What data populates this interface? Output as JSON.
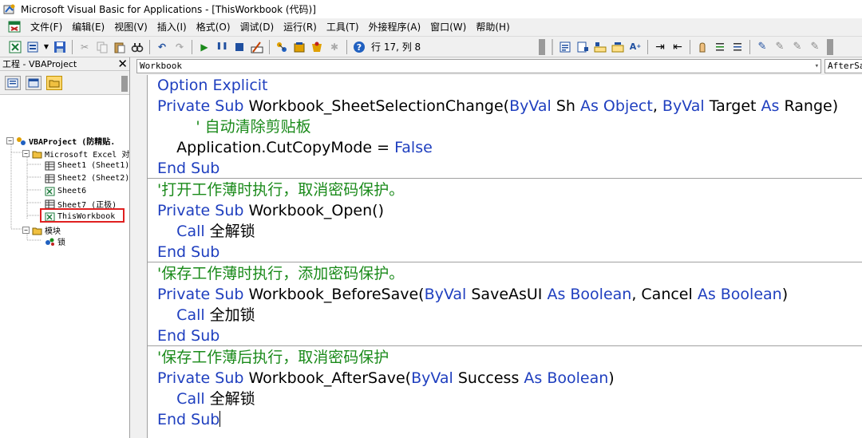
{
  "window": {
    "title": "Microsoft Visual Basic for Applications - [ThisWorkbook (代码)]"
  },
  "menu": [
    "文件(F)",
    "编辑(E)",
    "视图(V)",
    "插入(I)",
    "格式(O)",
    "调试(D)",
    "运行(R)",
    "工具(T)",
    "外接程序(A)",
    "窗口(W)",
    "帮助(H)"
  ],
  "toolbar": {
    "cursor_position": "行 17, 列 8"
  },
  "project": {
    "title": "工程 - VBAProject",
    "close_glyph": "✕",
    "root": "VBAProject (防精贴.",
    "excel_folder": "Microsoft Excel 对",
    "sheets": [
      "Sheet1 (Sheet1)",
      "Sheet2 (Sheet2)",
      "Sheet6",
      "Sheet7 (正极)"
    ],
    "this_workbook": "ThisWorkbook",
    "modules_folder": "模块",
    "module_item": "锁"
  },
  "code": {
    "object_combo": "Workbook",
    "proc_combo": "AfterSave",
    "lines": [
      [
        {
          "t": "Option Explicit",
          "c": "kw"
        }
      ],
      [
        {
          "t": "Private Sub",
          "c": "kw"
        },
        {
          "t": " Workbook_SheetSelectionChange(",
          "c": ""
        },
        {
          "t": "ByVal",
          "c": "kw"
        },
        {
          "t": " Sh ",
          "c": ""
        },
        {
          "t": "As Object",
          "c": "kw"
        },
        {
          "t": ", ",
          "c": ""
        },
        {
          "t": "ByVal",
          "c": "kw"
        },
        {
          "t": " Target ",
          "c": ""
        },
        {
          "t": "As",
          "c": "kw"
        },
        {
          "t": " Range)",
          "c": ""
        }
      ],
      [
        {
          "t": "        ' 自动清除剪贴板",
          "c": "cm"
        }
      ],
      [
        {
          "t": "    Application.CutCopyMode = ",
          "c": ""
        },
        {
          "t": "False",
          "c": "kw"
        }
      ],
      [
        {
          "t": "End Sub",
          "c": "kw"
        }
      ],
      [
        {
          "t": "'打开工作薄时执行，取消密码保护。",
          "c": "cm"
        }
      ],
      [
        {
          "t": "Private Sub",
          "c": "kw"
        },
        {
          "t": " Workbook_Open()",
          "c": ""
        }
      ],
      [
        {
          "t": "    ",
          "c": ""
        },
        {
          "t": "Call",
          "c": "kw"
        },
        {
          "t": " 全解锁",
          "c": ""
        }
      ],
      [
        {
          "t": "End Sub",
          "c": "kw"
        }
      ],
      [
        {
          "t": "'保存工作薄时执行，添加密码保护。",
          "c": "cm"
        }
      ],
      [
        {
          "t": "Private Sub",
          "c": "kw"
        },
        {
          "t": " Workbook_BeforeSave(",
          "c": ""
        },
        {
          "t": "ByVal",
          "c": "kw"
        },
        {
          "t": " SaveAsUI ",
          "c": ""
        },
        {
          "t": "As Boolean",
          "c": "kw"
        },
        {
          "t": ", Cancel ",
          "c": ""
        },
        {
          "t": "As Boolean",
          "c": "kw"
        },
        {
          "t": ")",
          "c": ""
        }
      ],
      [
        {
          "t": "    ",
          "c": ""
        },
        {
          "t": "Call",
          "c": "kw"
        },
        {
          "t": " 全加锁",
          "c": ""
        }
      ],
      [
        {
          "t": "End Sub",
          "c": "kw"
        }
      ],
      [
        {
          "t": "'保存工作薄后执行，取消密码保护",
          "c": "cm"
        }
      ],
      [
        {
          "t": "Private Sub",
          "c": "kw"
        },
        {
          "t": " Workbook_AfterSave(",
          "c": ""
        },
        {
          "t": "ByVal",
          "c": "kw"
        },
        {
          "t": " Success ",
          "c": ""
        },
        {
          "t": "As Boolean",
          "c": "kw"
        },
        {
          "t": ")",
          "c": ""
        }
      ],
      [
        {
          "t": "    ",
          "c": ""
        },
        {
          "t": "Call",
          "c": "kw"
        },
        {
          "t": " 全解锁",
          "c": ""
        }
      ],
      [
        {
          "t": "End Sub",
          "c": "kw"
        }
      ]
    ]
  },
  "colors": {
    "keyword": "#1f3fbf",
    "comment": "#1a8a1a",
    "selection_highlight": "#e02020"
  }
}
